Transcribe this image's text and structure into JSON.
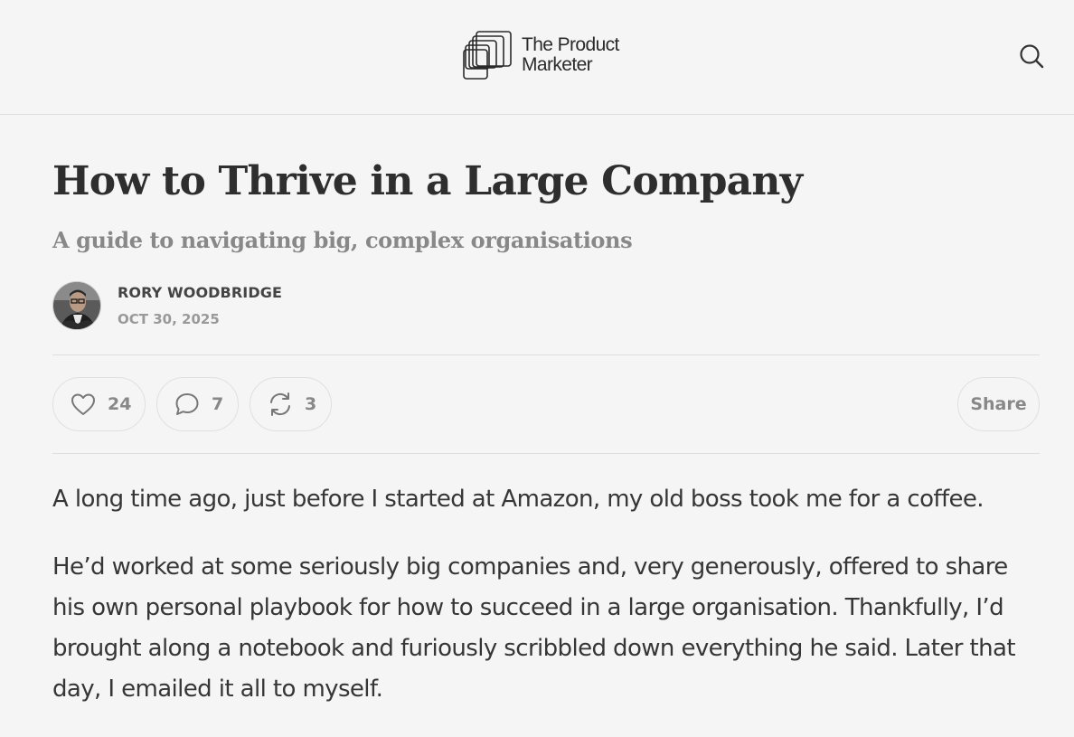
{
  "header": {
    "logo_line1": "The Product",
    "logo_line2": "Marketer",
    "logo_icon": "stacked-squares-logo",
    "search_icon": "search-icon"
  },
  "article": {
    "title": "How to Thrive in a Large Company",
    "subtitle": "A guide to navigating big, complex organisations",
    "author": "RORY WOODBRIDGE",
    "date": "OCT 30, 2025"
  },
  "actions": {
    "likes": "24",
    "comments": "7",
    "restacks": "3",
    "share_label": "Share"
  },
  "body": {
    "paragraphs": [
      "A long time ago, just before I started at Amazon, my old boss took me for a coffee.",
      "He’d worked at some seriously big companies and, very generously, offered to share his own personal playbook for how to succeed in a large organisation. Thankfully, I’d brought along a notebook and furiously scribbled down everything he said. Later that day, I emailed it all to myself."
    ]
  },
  "colors": {
    "background": "#f5f5f5",
    "text": "#333333",
    "muted": "#888888",
    "border": "#dedede"
  }
}
